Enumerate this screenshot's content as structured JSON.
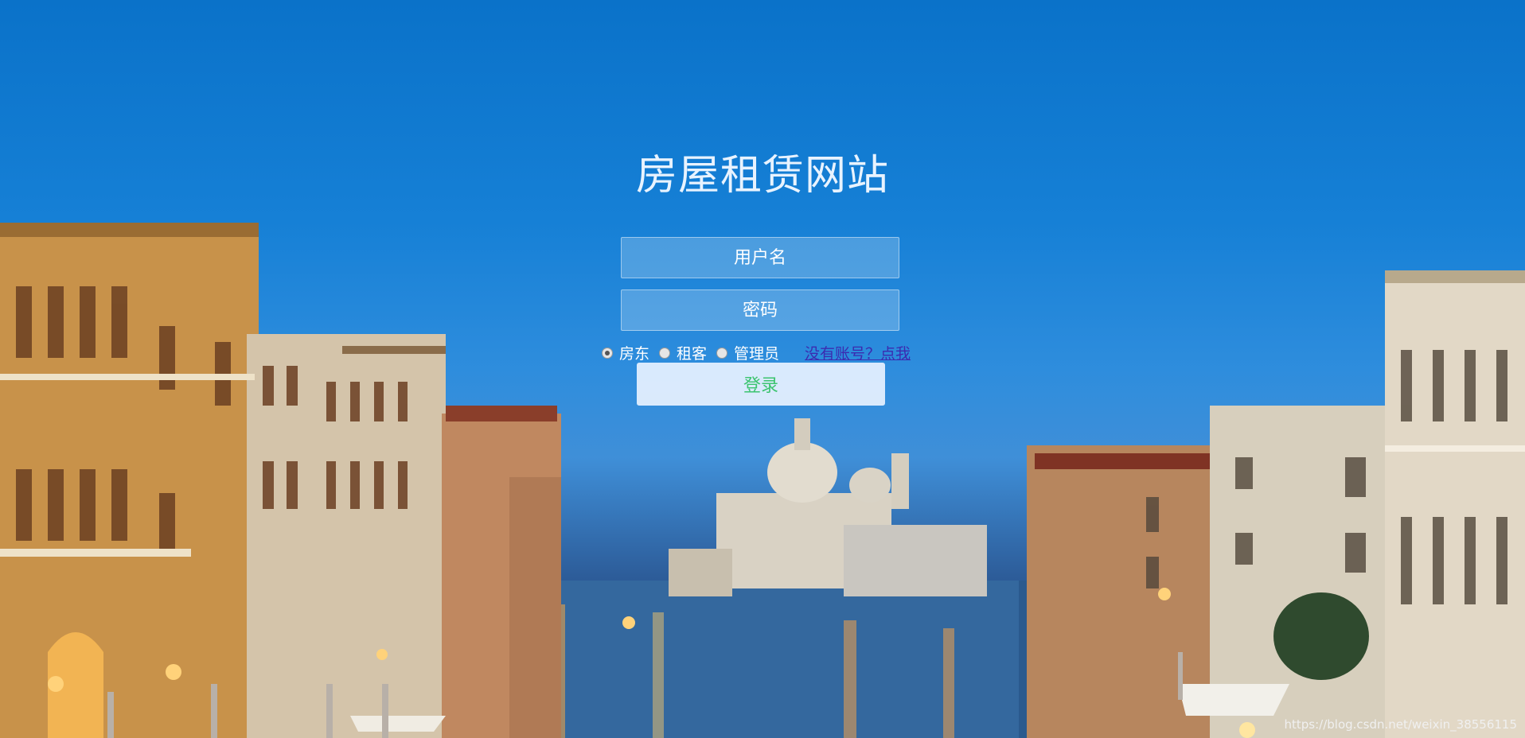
{
  "page": {
    "title": "房屋租赁网站"
  },
  "form": {
    "username_placeholder": "用户名",
    "password_placeholder": "密码",
    "roles": [
      {
        "label": "房东",
        "checked": true
      },
      {
        "label": "租客",
        "checked": false
      },
      {
        "label": "管理员",
        "checked": false
      }
    ],
    "register_link": "没有账号？点我",
    "login_button": "登录"
  },
  "footer": {
    "watermark": "https://blog.csdn.net/weixin_38556115"
  },
  "colors": {
    "sky": "#1680d6",
    "login_text": "#3cc46f",
    "link": "#3b2bb0"
  }
}
